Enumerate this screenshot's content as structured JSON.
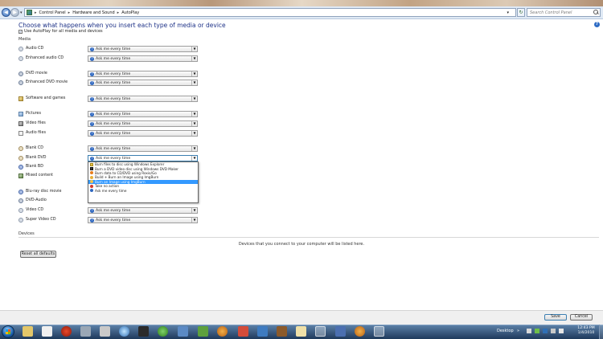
{
  "address_bar": {
    "crumbs": [
      "Control Panel",
      "Hardware and Sound",
      "AutoPlay"
    ],
    "search_placeholder": "Search Control Panel"
  },
  "page": {
    "title": "Choose what happens when you insert each type of media or device",
    "use_autoplay_label": "Use AutoPlay for all media and devices",
    "use_autoplay_checked": true,
    "media_section": "Media",
    "devices_section": "Devices",
    "devices_message": "Devices that you connect to your computer will be listed here.",
    "reset_label": "Reset all defaults"
  },
  "media_items": [
    {
      "label": "Audio CD",
      "value": "Ask me every time",
      "icon": "cd-icon"
    },
    {
      "label": "Enhanced audio CD",
      "value": "Ask me every time",
      "icon": "cd-icon"
    },
    {
      "label": "DVD movie",
      "value": "Ask me every time",
      "icon": "dvd-icon"
    },
    {
      "label": "Enhanced DVD movie",
      "value": "Ask me every time",
      "icon": "dvd-icon"
    },
    {
      "label": "Software and games",
      "value": "Ask me every time",
      "icon": "software-icon"
    },
    {
      "label": "Pictures",
      "value": "Ask me every time",
      "icon": "pictures-icon"
    },
    {
      "label": "Video files",
      "value": "Ask me every time",
      "icon": "video-icon"
    },
    {
      "label": "Audio files",
      "value": "Ask me every time",
      "icon": "audio-file-icon"
    },
    {
      "label": "Blank CD",
      "value": "Ask me every time",
      "icon": "blank-cd-icon"
    },
    {
      "label": "Blank DVD",
      "value": "Ask me every time",
      "icon": "blank-dvd-icon"
    },
    {
      "label": "Blank BD",
      "value": "",
      "icon": "blank-bd-icon"
    },
    {
      "label": "Mixed content",
      "value": "",
      "icon": "mixed-content-icon"
    },
    {
      "label": "Blu-ray disc movie",
      "value": "",
      "icon": "bluray-icon"
    },
    {
      "label": "DVD-Audio",
      "value": "",
      "icon": "dvd-audio-icon"
    },
    {
      "label": "Video CD",
      "value": "Ask me every time",
      "icon": "video-cd-icon"
    },
    {
      "label": "Super Video CD",
      "value": "Ask me every time",
      "icon": "svcd-icon"
    }
  ],
  "open_dropdown": {
    "for": "Blank DVD",
    "selected_index": 4,
    "options": [
      "Burn files to disc using Windows Explorer",
      "Burn a DVD video disc using Windows DVD Maker",
      "Burn data to CD/DVD using Roxio/Go",
      "Build + Burn an Image using ImgBurn",
      "Burn an Image using ImgBurn",
      "Take no action",
      "Ask me every time"
    ],
    "option_icons": [
      "explorer-icon",
      "dvd-maker-icon",
      "roxio-icon",
      "imgburn-icon",
      "imgburn-icon",
      "no-action-icon",
      "ask-icon"
    ]
  },
  "footer": {
    "save_label": "Save",
    "cancel_label": "Cancel"
  },
  "taskbar": {
    "desktop_label": "Desktop",
    "time": "12:43 PM",
    "date": "1/4/2010"
  },
  "colors": {
    "title": "#1e3287",
    "selection": "#3399ff",
    "taskbar": "#1f3a5c"
  }
}
